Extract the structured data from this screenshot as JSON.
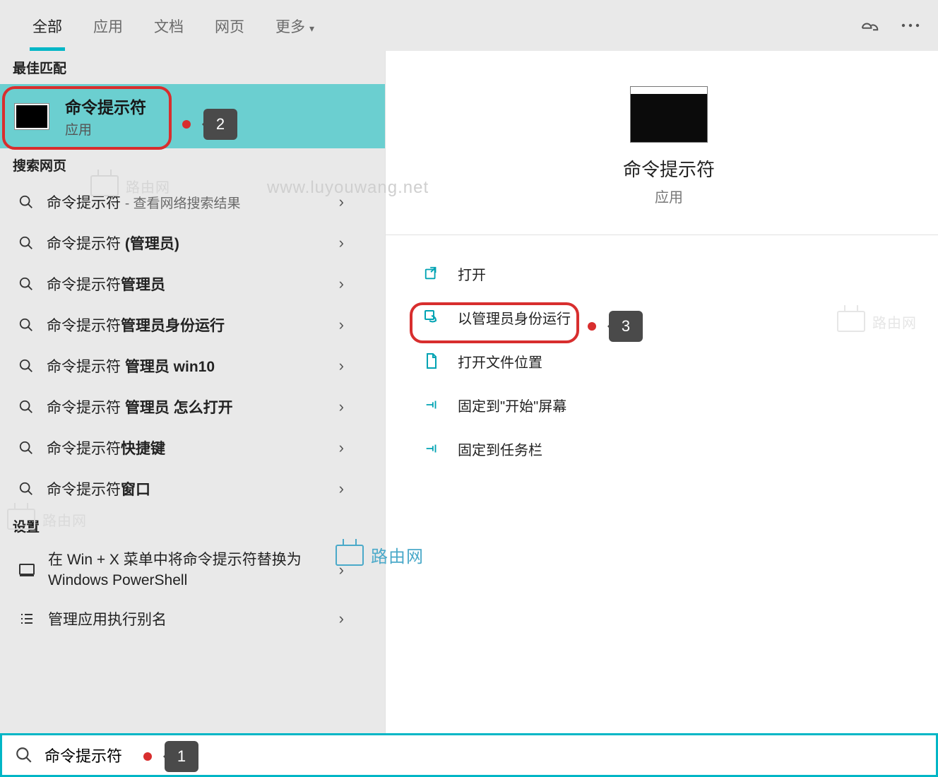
{
  "tabs": {
    "all": "全部",
    "apps": "应用",
    "documents": "文档",
    "web": "网页",
    "more": "更多"
  },
  "sections": {
    "best_match": "最佳匹配",
    "search_web": "搜索网页",
    "settings": "设置"
  },
  "best_match": {
    "title": "命令提示符",
    "subtitle": "应用"
  },
  "web_results": [
    {
      "prefix": "命令提示符 ",
      "bold": "",
      "hint": "- 查看网络搜索结果"
    },
    {
      "prefix": "命令提示符  ",
      "bold": "(管理员)",
      "hint": ""
    },
    {
      "prefix": "命令提示符",
      "bold": "管理员",
      "hint": ""
    },
    {
      "prefix": "命令提示符",
      "bold": "管理员身份运行",
      "hint": ""
    },
    {
      "prefix": "命令提示符 ",
      "bold": "管理员 win10",
      "hint": ""
    },
    {
      "prefix": "命令提示符 ",
      "bold": "管理员 怎么打开",
      "hint": ""
    },
    {
      "prefix": "命令提示符",
      "bold": "快捷键",
      "hint": ""
    },
    {
      "prefix": "命令提示符",
      "bold": "窗口",
      "hint": ""
    }
  ],
  "settings_items": {
    "replace_powershell": "在 Win + X 菜单中将命令提示符替换为 Windows PowerShell",
    "app_aliases": "管理应用执行别名"
  },
  "right_panel": {
    "title": "命令提示符",
    "subtitle": "应用",
    "actions": {
      "open": "打开",
      "run_admin": "以管理员身份运行",
      "open_location": "打开文件位置",
      "pin_start": "固定到\"开始\"屏幕",
      "pin_taskbar": "固定到任务栏"
    }
  },
  "search": {
    "value": "命令提示符"
  },
  "callouts": {
    "one": "1",
    "two": "2",
    "three": "3"
  },
  "watermark": {
    "text_cn": "路由网",
    "text_url": "www.luyouwang.net"
  }
}
